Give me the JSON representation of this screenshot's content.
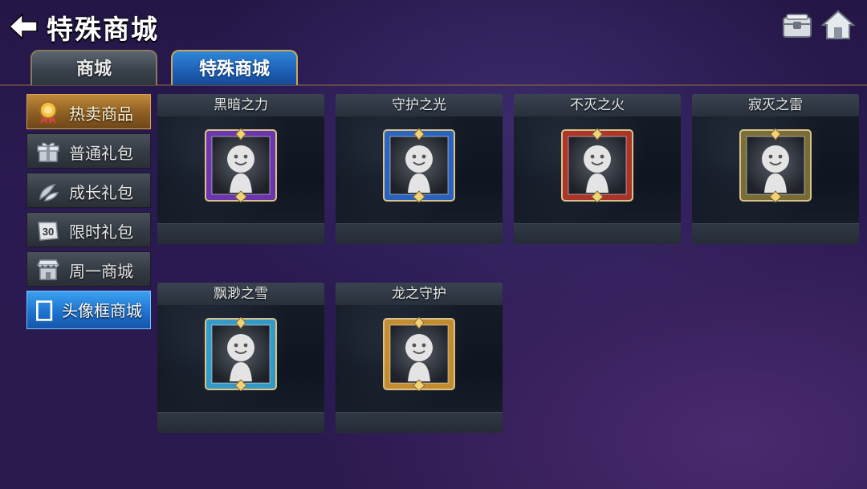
{
  "header": {
    "title": "特殊商城",
    "back_icon": "arrow-left-icon",
    "chest_icon": "treasure-chest-icon",
    "home_icon": "home-icon"
  },
  "tabs": [
    {
      "label": "商城",
      "active": false
    },
    {
      "label": "特殊商城",
      "active": true
    }
  ],
  "sidebar": {
    "items": [
      {
        "label": "热卖商品",
        "icon": "medal-icon",
        "active": true
      },
      {
        "label": "普通礼包",
        "icon": "gift-box-icon",
        "active": false
      },
      {
        "label": "成长礼包",
        "icon": "growth-icon",
        "active": false
      },
      {
        "label": "限时礼包",
        "icon": "timer-30-icon",
        "badge": "30",
        "active": false
      },
      {
        "label": "周一商城",
        "icon": "shop-awning-icon",
        "active": false
      },
      {
        "label": "头像框商城",
        "icon": "frame-icon",
        "active": true
      }
    ]
  },
  "cards": [
    {
      "name": "黑暗之力",
      "color": "#7a3bc4"
    },
    {
      "name": "守护之光",
      "color": "#2f6fd6"
    },
    {
      "name": "不灭之火",
      "color": "#c43a2a"
    },
    {
      "name": "寂灭之雷",
      "color": "#8a7a3a"
    },
    {
      "name": "飘渺之雪",
      "color": "#3ab0e0"
    },
    {
      "name": "龙之守护",
      "color": "#e0a030"
    }
  ]
}
